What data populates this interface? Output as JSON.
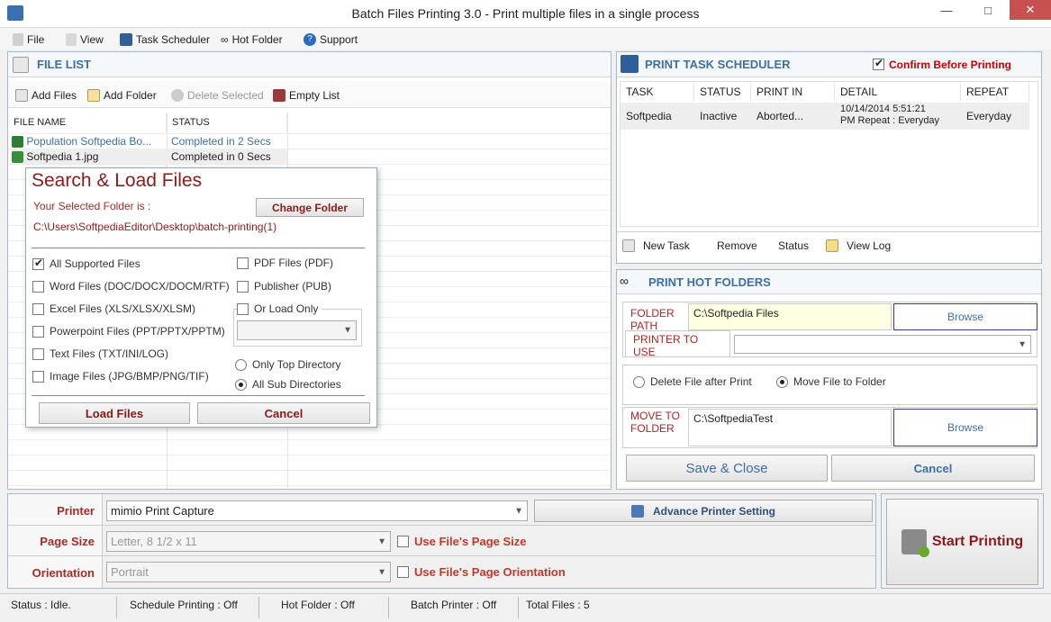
{
  "window": {
    "title": "Batch Files Printing 3.0 - Print multiple files in a single process"
  },
  "menu": {
    "items": [
      "File",
      "View",
      "Task Scheduler",
      "Hot Folder",
      "Support"
    ]
  },
  "file_list": {
    "title": "FILE LIST",
    "toolbar": {
      "add_files": "Add Files",
      "add_folder": "Add Folder",
      "delete_selected": "Delete Selected",
      "empty_list": "Empty List"
    },
    "columns": [
      "FILE NAME",
      "STATUS"
    ],
    "rows": [
      {
        "name": "Population Softpedia Bo...",
        "status": "Completed in 2 Secs"
      },
      {
        "name": "Softpedia 1.jpg",
        "status": "Completed in 0 Secs"
      }
    ]
  },
  "search_dialog": {
    "title": "Search & Load Files",
    "selected_folder_label": "Your Selected Folder is :",
    "change_folder": "Change Folder",
    "folder_path": "C:\\Users\\SoftpediaEditor\\Desktop\\batch-printing(1)",
    "left_options": [
      {
        "label": "All Supported Files",
        "checked": true
      },
      {
        "label": "Word Files (DOC/DOCX/DOCM/RTF)",
        "checked": false
      },
      {
        "label": "Excel Files (XLS/XLSX/XLSM)",
        "checked": false
      },
      {
        "label": "Powerpoint Files (PPT/PPTX/PPTM)",
        "checked": false
      },
      {
        "label": "Text Files (TXT/INI/LOG)",
        "checked": false
      },
      {
        "label": "Image Files (JPG/BMP/PNG/TIF)",
        "checked": false
      }
    ],
    "right_options": [
      {
        "label": "PDF Files (PDF)",
        "checked": false
      },
      {
        "label": "Publisher (PUB)",
        "checked": false
      }
    ],
    "or_load_only": "Or Load Only",
    "only_top_directory": "Only Top Directory",
    "all_sub_directories": "All Sub Directories",
    "load_files": "Load Files",
    "cancel": "Cancel"
  },
  "scheduler": {
    "title": "PRINT TASK SCHEDULER",
    "confirm_label": "Confirm Before Printing",
    "columns": [
      "TASK",
      "STATUS",
      "PRINT IN",
      "DETAIL",
      "REPEAT"
    ],
    "rows": [
      {
        "task": "Softpedia",
        "status": "Inactive",
        "print_in": "Aborted...",
        "detail_1": "10/14/2014 5:51:21",
        "detail_2": "PM Repeat : Everyday",
        "repeat": "Everyday"
      }
    ],
    "toolbar": {
      "new_task": "New Task",
      "remove": "Remove",
      "status": "Status",
      "view_log": "View Log"
    }
  },
  "hot_folders": {
    "title": "PRINT HOT FOLDERS",
    "folder_path_label": "FOLDER PATH",
    "folder_path_value": "C:\\Softpedia Files",
    "browse": "Browse",
    "printer_to_use_label": "PRINTER TO USE",
    "delete_after_print": "Delete File after Print",
    "move_to_folder_option": "Move File to Folder",
    "move_to_folder_label": "MOVE TO FOLDER",
    "move_to_folder_value": "C:\\SoftpediaTest",
    "browse2": "Browse",
    "save_close": "Save & Close",
    "cancel": "Cancel"
  },
  "printer_settings": {
    "printer_label": "Printer",
    "printer_value": "mimio Print Capture",
    "advance_setting": "Advance Printer Setting",
    "page_size_label": "Page Size",
    "page_size_value": "Letter, 8 1/2 x 11",
    "use_file_page_size": "Use File's Page Size",
    "orientation_label": "Orientation",
    "orientation_value": "Portrait",
    "use_file_orientation": "Use File's Page Orientation",
    "start_printing": "Start Printing"
  },
  "statusbar": {
    "status": "Status :  Idle.",
    "schedule": "Schedule Printing : Off",
    "hot_folder": "Hot Folder : Off",
    "batch_printer": "Batch Printer : Off",
    "total_files": "Total Files :  5"
  },
  "colors": {
    "header_blue": "#3d6fa4",
    "label_red": "#a52a2a",
    "dialog_title": "#8b1a1a"
  }
}
